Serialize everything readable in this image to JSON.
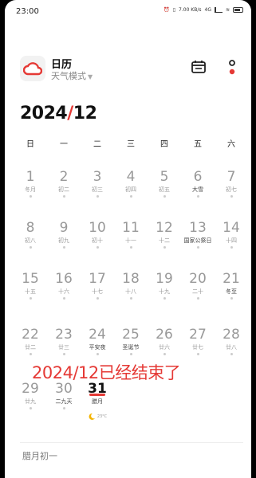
{
  "status_bar": {
    "time": "23:00",
    "net_speed": "7.00 KB/s",
    "network": "4G"
  },
  "header": {
    "title": "日历",
    "subtitle": "天气模式",
    "calendar_icon": "calendar-icon",
    "more_icon": "more-icon",
    "accent": "#e53935"
  },
  "month": {
    "year": "2024",
    "slash": "/",
    "month": "12"
  },
  "weekdays": [
    "日",
    "一",
    "二",
    "三",
    "四",
    "五",
    "六"
  ],
  "weeks": [
    [
      {
        "d": "1",
        "l": "冬月"
      },
      {
        "d": "2",
        "l": "初二"
      },
      {
        "d": "3",
        "l": "初三"
      },
      {
        "d": "4",
        "l": "初四"
      },
      {
        "d": "5",
        "l": "初五"
      },
      {
        "d": "6",
        "l": "大雪"
      },
      {
        "d": "7",
        "l": "初七"
      }
    ],
    [
      {
        "d": "8",
        "l": "初八"
      },
      {
        "d": "9",
        "l": "初九"
      },
      {
        "d": "10",
        "l": "初十"
      },
      {
        "d": "11",
        "l": "十一"
      },
      {
        "d": "12",
        "l": "十二"
      },
      {
        "d": "13",
        "l": "国家公祭日"
      },
      {
        "d": "14",
        "l": "十四"
      }
    ],
    [
      {
        "d": "15",
        "l": "十五"
      },
      {
        "d": "16",
        "l": "十六"
      },
      {
        "d": "17",
        "l": "十七"
      },
      {
        "d": "18",
        "l": "十八"
      },
      {
        "d": "19",
        "l": "十九"
      },
      {
        "d": "20",
        "l": "二十"
      },
      {
        "d": "21",
        "l": "冬至"
      }
    ],
    [
      {
        "d": "22",
        "l": "廿二"
      },
      {
        "d": "23",
        "l": "廿三"
      },
      {
        "d": "24",
        "l": "平安夜"
      },
      {
        "d": "25",
        "l": "圣诞节"
      },
      {
        "d": "26",
        "l": "廿六"
      },
      {
        "d": "27",
        "l": "廿七"
      },
      {
        "d": "28",
        "l": "廿八"
      }
    ],
    [
      {
        "d": "29",
        "l": "廿九"
      },
      {
        "d": "30",
        "l": "二九天"
      },
      {
        "d": "31",
        "l": "腊月",
        "today": true,
        "weather": "moon",
        "temp": "23°C"
      }
    ]
  ],
  "overlay_message": "2024/12已经结束了",
  "footer": {
    "lunar_date": "腊月初一"
  }
}
